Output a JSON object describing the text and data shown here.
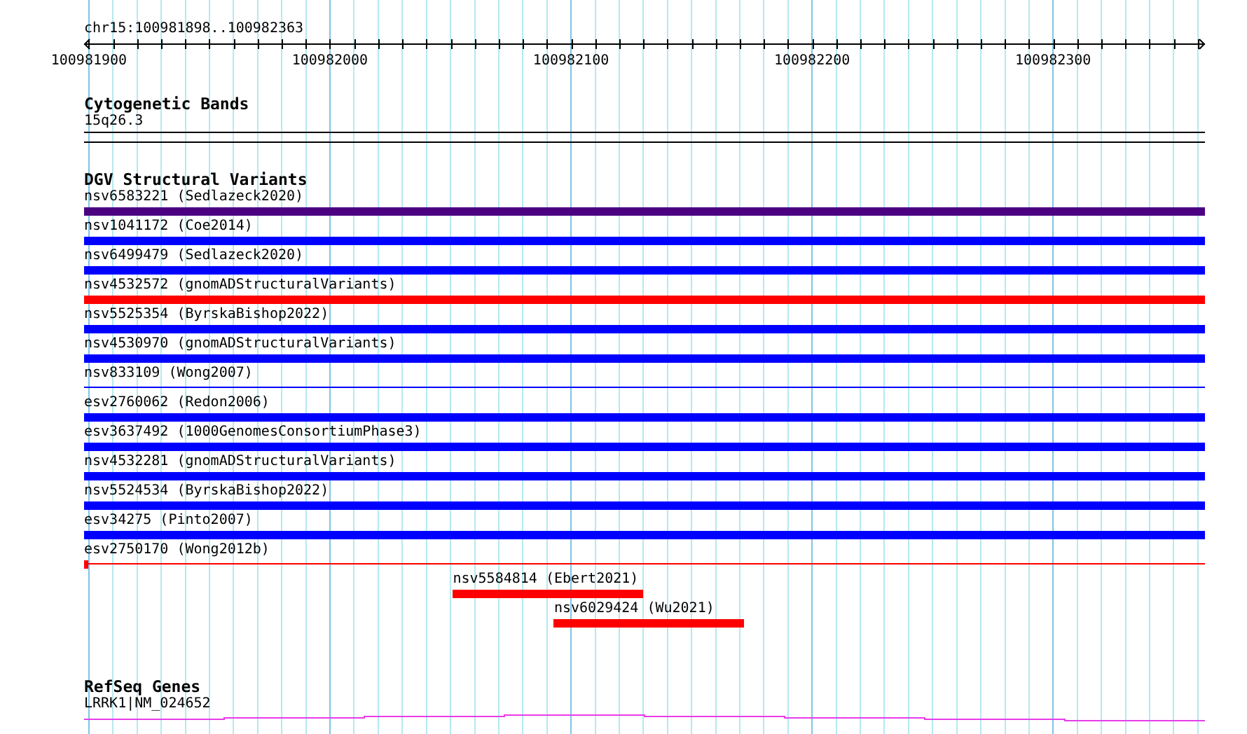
{
  "ruler": {
    "title": "chr15:100981898..100982363",
    "tick_labels": [
      "100981900",
      "100982000",
      "100982100",
      "100982200",
      "100982300"
    ]
  },
  "cytogenetic_bands": {
    "title": "Cytogenetic Bands",
    "band": {
      "label": "15q26.3"
    }
  },
  "dgv_structural_variants": {
    "title": "DGV Structural Variants",
    "variants": [
      {
        "label": "nsv6583221 (Sedlazeck2020)",
        "color": "#4b0082",
        "kind": "bar"
      },
      {
        "label": "nsv1041172 (Coe2014)",
        "color": "#0000ff",
        "kind": "bar"
      },
      {
        "label": "nsv6499479 (Sedlazeck2020)",
        "color": "#0000ff",
        "kind": "bar"
      },
      {
        "label": "nsv4532572 (gnomADStructuralVariants)",
        "color": "#ff0000",
        "kind": "bar"
      },
      {
        "label": "nsv5525354 (ByrskaBishop2022)",
        "color": "#0000ff",
        "kind": "bar"
      },
      {
        "label": "nsv4530970 (gnomADStructuralVariants)",
        "color": "#0000ff",
        "kind": "bar"
      },
      {
        "label": "nsv833109 (Wong2007)",
        "color": "#0000ff",
        "kind": "line"
      },
      {
        "label": "esv2760062 (Redon2006)",
        "color": "#0000ff",
        "kind": "bar"
      },
      {
        "label": "esv3637492 (1000GenomesConsortiumPhase3)",
        "color": "#0000ff",
        "kind": "bar"
      },
      {
        "label": "nsv4532281 (gnomADStructuralVariants)",
        "color": "#0000ff",
        "kind": "bar"
      },
      {
        "label": "nsv5524534 (ByrskaBishop2022)",
        "color": "#0000ff",
        "kind": "bar"
      },
      {
        "label": "esv34275 (Pinto2007)",
        "color": "#0000ff",
        "kind": "bar"
      },
      {
        "label": "esv2750170 (Wong2012b)",
        "color": "#ff0000",
        "kind": "split"
      },
      {
        "label": "nsv5584814 (Ebert2021)",
        "color": "#ff0000",
        "kind": "bar"
      },
      {
        "label": "nsv6029424 (Wu2021)",
        "color": "#ff0000",
        "kind": "bar"
      }
    ]
  },
  "refseq_genes": {
    "title": "RefSeq Genes",
    "genes": [
      {
        "label": "LRRK1|NM_024652"
      }
    ]
  }
}
